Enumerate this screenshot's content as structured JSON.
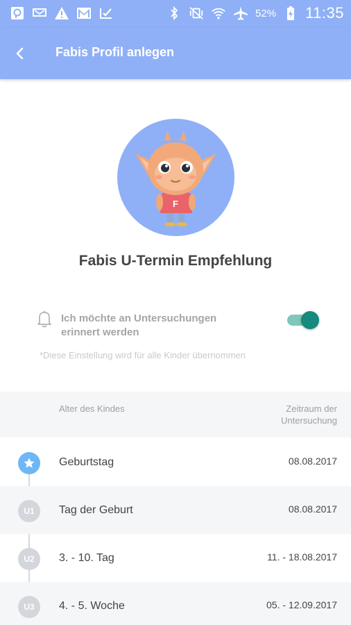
{
  "status_bar": {
    "battery": "52%",
    "time": "11:35"
  },
  "app_bar": {
    "title": "Fabis Profil anlegen"
  },
  "section": {
    "title": "Fabis U-Termin Empfehlung"
  },
  "reminder": {
    "label": "Ich möchte an Untersuchungen erinnert werden",
    "enabled": true,
    "hint": "*Diese Einstellung wird für alle Kinder übernommen"
  },
  "table": {
    "col_age": "Alter des Kindes",
    "col_period": "Zeitraum der Untersuchung",
    "rows": [
      {
        "badge": "",
        "label": "Geburtstag",
        "date": "08.08.2017"
      },
      {
        "badge": "U1",
        "label": "Tag der Geburt",
        "date": "08.08.2017"
      },
      {
        "badge": "U2",
        "label": "3. - 10. Tag",
        "date": "11. - 18.08.2017"
      },
      {
        "badge": "U3",
        "label": "4. - 5. Woche",
        "date": "05. - 12.09.2017"
      }
    ]
  },
  "colors": {
    "primary": "#8fb0f6",
    "toggle_on": "#168a7c",
    "star_badge": "#6eb7f5"
  }
}
